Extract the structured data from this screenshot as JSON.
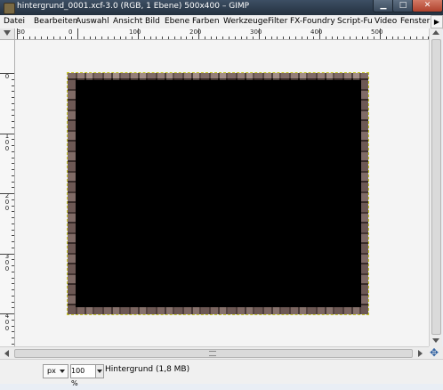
{
  "window": {
    "title": "hintergrund_0001.xcf-3.0 (RGB, 1 Ebene) 500x400 – GIMP",
    "buttons": {
      "minimize": "▁",
      "maximize": "□",
      "close": "✕"
    }
  },
  "menubar": {
    "items": [
      "Datei",
      "Bearbeiten",
      "Auswahl",
      "Ansicht",
      "Bild",
      "Ebene",
      "Farben",
      "Werkzeuge",
      "Filter",
      "FX-Foundry",
      "Script-Fu",
      "Video",
      "Fenster"
    ],
    "overflow_arrow": "▶"
  },
  "ruler_top": {
    "labels": [
      "30",
      "0",
      "100",
      "200",
      "300",
      "400",
      "500"
    ]
  },
  "ruler_left": {
    "labels": [
      "0",
      "100",
      "200",
      "300",
      "400"
    ]
  },
  "canvas": {
    "border_texture_colors": [
      "#6b5552",
      "#2a1d1a",
      "#8d746e",
      "#a59088"
    ],
    "image_fill": "#000000",
    "selection_outline": "#c8c829"
  },
  "statusbar": {
    "unit": "px",
    "zoom": "100 %",
    "message": "Hintergrund (1,8 MB)"
  },
  "icons": {
    "navigate": "navigate-icon",
    "app": "gimp-app-icon"
  },
  "colors": {
    "titlebar": "#2f3e50",
    "close_button": "#c45a44",
    "canvas_bg": "#f4f4f4"
  }
}
